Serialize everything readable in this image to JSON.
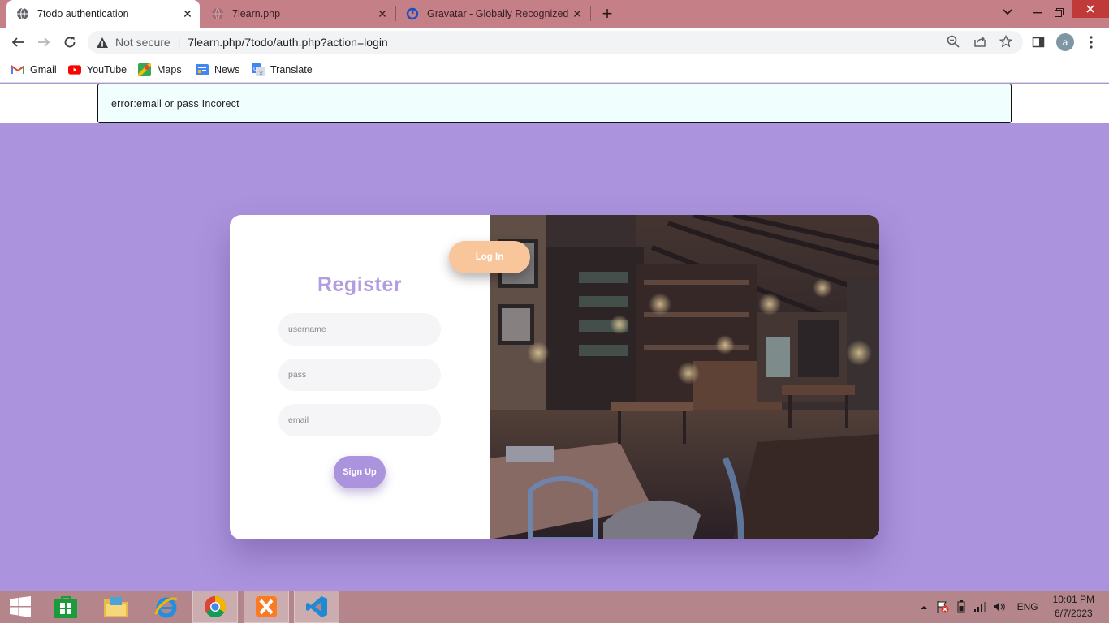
{
  "browser": {
    "tabs": [
      {
        "title": "7todo authentication",
        "active": true
      },
      {
        "title": "7learn.php",
        "active": false
      },
      {
        "title": "Gravatar - Globally Recognized A",
        "active": false
      }
    ],
    "new_tab": "+",
    "security_label": "Not secure",
    "url": "7learn.php/7todo/auth.php?action=login",
    "profile_initial": "a",
    "bookmarks": [
      "Gmail",
      "YouTube",
      "Maps",
      "News",
      "Translate"
    ]
  },
  "page": {
    "alert": "error:email or pass Incorect",
    "form": {
      "title": "Register",
      "username_placeholder": "username",
      "pass_placeholder": "pass",
      "email_placeholder": "email",
      "signup_label": "Sign Up"
    },
    "login_label": "Log In"
  },
  "taskbar": {
    "language": "ENG",
    "time": "10:01 PM",
    "date": "6/7/2023"
  },
  "colors": {
    "page_bg": "#ab93dd",
    "tabstrip": "#c47f87",
    "accent_purple": "#b29ddf",
    "login_peach": "#f9c59b",
    "taskbar": "#b4858a"
  }
}
